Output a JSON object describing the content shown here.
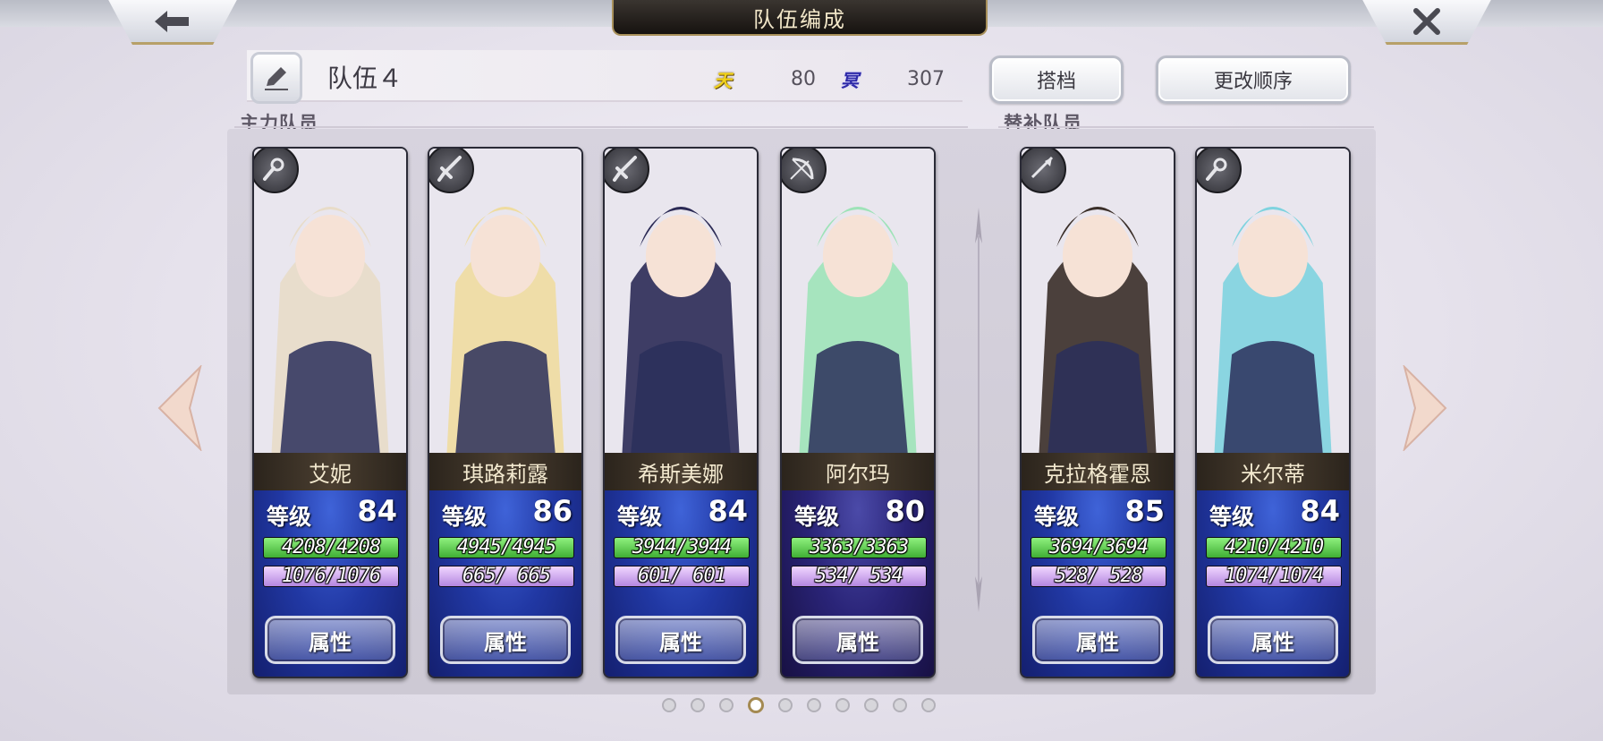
{
  "header": {
    "title": "队伍编成",
    "back_label": "back",
    "close_label": "close"
  },
  "team": {
    "name": "队伍４",
    "heaven_badge": "天",
    "heaven_value": "80",
    "nether_badge": "冥",
    "nether_value": "307",
    "partner_button": "搭档",
    "reorder_button": "更改顺序"
  },
  "sections": {
    "main_members": "主力队员",
    "reserve_members": "替补队员"
  },
  "main_cards": [
    {
      "name": "艾妮",
      "level_label": "等级",
      "level": "84",
      "hp": "4208/4208",
      "hp_ratio": 1.0,
      "mp": "1076/1076",
      "mp_ratio": 1.0,
      "attr_label": "属性",
      "class_icon": "staff-icon",
      "hair": "#e8dcc8",
      "theme": "blue"
    },
    {
      "name": "琪路莉露",
      "level_label": "等级",
      "level": "86",
      "hp": "4945/4945",
      "hp_ratio": 1.0,
      "mp": "665/ 665",
      "mp_ratio": 1.0,
      "attr_label": "属性",
      "class_icon": "sword-icon",
      "hair": "#efdca0",
      "theme": "blue"
    },
    {
      "name": "希斯美娜",
      "level_label": "等级",
      "level": "84",
      "hp": "3944/3944",
      "hp_ratio": 1.0,
      "mp": "601/ 601",
      "mp_ratio": 1.0,
      "attr_label": "属性",
      "class_icon": "sword-icon",
      "hair": "#2b2a55",
      "theme": "blue"
    },
    {
      "name": "阿尔玛",
      "level_label": "等级",
      "level": "80",
      "hp": "3363/3363",
      "hp_ratio": 1.0,
      "mp": "534/ 534",
      "mp_ratio": 1.0,
      "attr_label": "属性",
      "class_icon": "bow-icon",
      "hair": "#9ee3b8",
      "theme": "purple"
    }
  ],
  "reserve_cards": [
    {
      "name": "克拉格霍恩",
      "level_label": "等级",
      "level": "85",
      "hp": "3694/3694",
      "hp_ratio": 1.0,
      "mp": "528/ 528",
      "mp_ratio": 1.0,
      "attr_label": "属性",
      "class_icon": "spear-icon",
      "hair": "#3a2e28",
      "theme": "blue"
    },
    {
      "name": "米尔蒂",
      "level_label": "等级",
      "level": "84",
      "hp": "4210/4210",
      "hp_ratio": 1.0,
      "mp": "1074/1074",
      "mp_ratio": 1.0,
      "attr_label": "属性",
      "class_icon": "staff-icon",
      "hair": "#7fd3df",
      "theme": "blue"
    }
  ],
  "pagination": {
    "total": 10,
    "current": 4
  },
  "colors": {
    "gold_trim": "#a8905a",
    "hp_green": "#3fae34",
    "mp_lilac": "#b487e0"
  }
}
